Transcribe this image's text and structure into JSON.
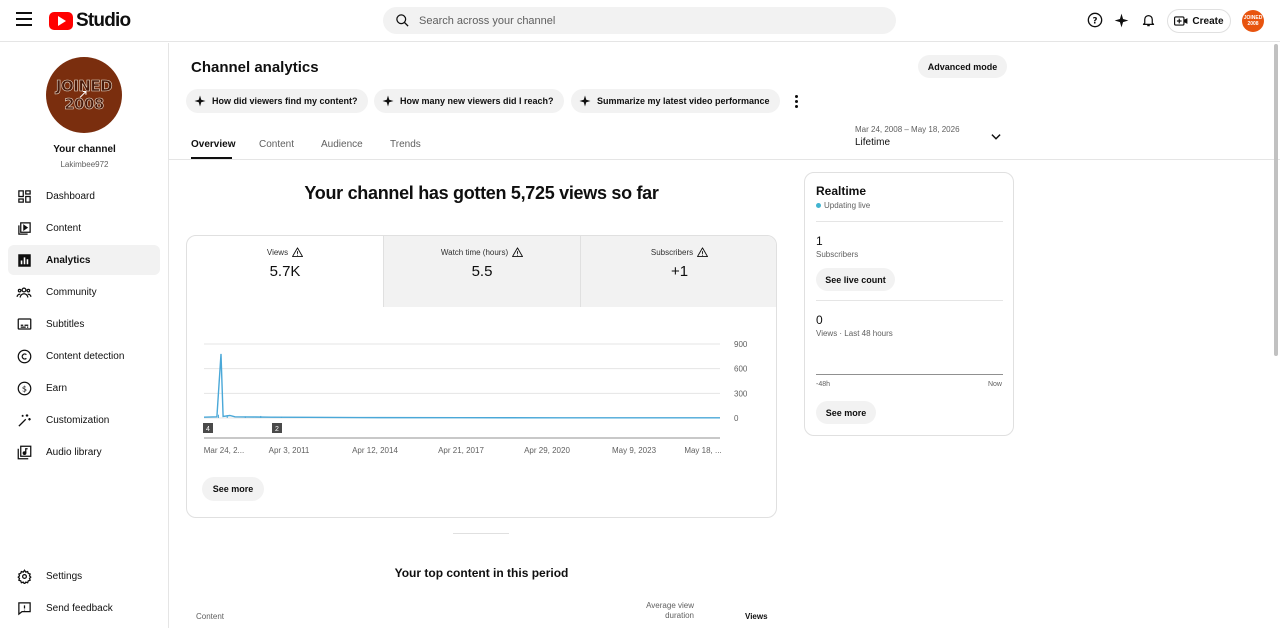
{
  "header": {
    "logo_text": "Studio",
    "search_placeholder": "Search across your channel",
    "create_label": "Create",
    "avatar_text": "JOINED 2008"
  },
  "sidebar": {
    "avatar_line1": "JOINED",
    "avatar_line2": "2008",
    "channel_title": "Your channel",
    "channel_handle": "Lakimbee972",
    "items": [
      {
        "label": "Dashboard",
        "icon": "dashboard-icon"
      },
      {
        "label": "Content",
        "icon": "content-icon"
      },
      {
        "label": "Analytics",
        "icon": "analytics-icon",
        "active": true
      },
      {
        "label": "Community",
        "icon": "community-icon"
      },
      {
        "label": "Subtitles",
        "icon": "subtitles-icon"
      },
      {
        "label": "Content detection",
        "icon": "copyright-icon"
      },
      {
        "label": "Earn",
        "icon": "dollar-icon"
      },
      {
        "label": "Customization",
        "icon": "magic-wand-icon"
      },
      {
        "label": "Audio library",
        "icon": "audio-library-icon"
      }
    ],
    "footer_items": [
      {
        "label": "Settings",
        "icon": "gear-icon"
      },
      {
        "label": "Send feedback",
        "icon": "feedback-icon"
      }
    ]
  },
  "main": {
    "title": "Channel analytics",
    "advanced_mode": "Advanced mode",
    "chips": [
      "How did viewers find my content?",
      "How many new viewers did I reach?",
      "Summarize my latest video performance"
    ],
    "tabs": [
      "Overview",
      "Content",
      "Audience",
      "Trends"
    ],
    "active_tab": "Overview",
    "date_range": "Mar 24, 2008 – May 18, 2026",
    "date_label": "Lifetime",
    "headline": "Your channel has gotten 5,725 views so far",
    "metrics": [
      {
        "label": "Views",
        "value": "5.7K"
      },
      {
        "label": "Watch time (hours)",
        "value": "5.5"
      },
      {
        "label": "Subscribers",
        "value": "+1"
      }
    ],
    "see_more": "See more",
    "top_content_title": "Your top content in this period",
    "table_headers": {
      "content": "Content",
      "avg_view_duration_line1": "Average view",
      "avg_view_duration_line2": "duration",
      "views": "Views"
    }
  },
  "chart_data": {
    "type": "line",
    "ylim": [
      0,
      900
    ],
    "y_ticks": [
      "900",
      "600",
      "300",
      "0"
    ],
    "x_tick_labels": [
      "Mar 24, 2...",
      "Apr 3, 2011",
      "Apr 12, 2014",
      "Apr 21, 2017",
      "Apr 29, 2020",
      "May 9, 2023",
      "May 18, ..."
    ],
    "markers": [
      "4",
      "2"
    ],
    "series": [
      {
        "values_note": "daily views",
        "peak_value": 780,
        "points": [
          [
            0.0,
            10
          ],
          [
            0.025,
            15
          ],
          [
            0.033,
            780
          ],
          [
            0.037,
            20
          ],
          [
            0.05,
            30
          ],
          [
            0.06,
            15
          ],
          [
            0.1,
            12
          ],
          [
            0.13,
            10
          ],
          [
            0.2,
            8
          ],
          [
            0.3,
            5
          ],
          [
            0.5,
            4
          ],
          [
            0.7,
            3
          ],
          [
            1.0,
            3
          ]
        ]
      }
    ],
    "accent_color": "#4aa8d8"
  },
  "realtime": {
    "title": "Realtime",
    "live_text": "Updating live",
    "subscribers_value": "1",
    "subscribers_label": "Subscribers",
    "live_count_btn": "See live count",
    "views_value": "0",
    "views_label": "Views · Last 48 hours",
    "axis_start": "-48h",
    "axis_end": "Now",
    "see_more": "See more"
  }
}
